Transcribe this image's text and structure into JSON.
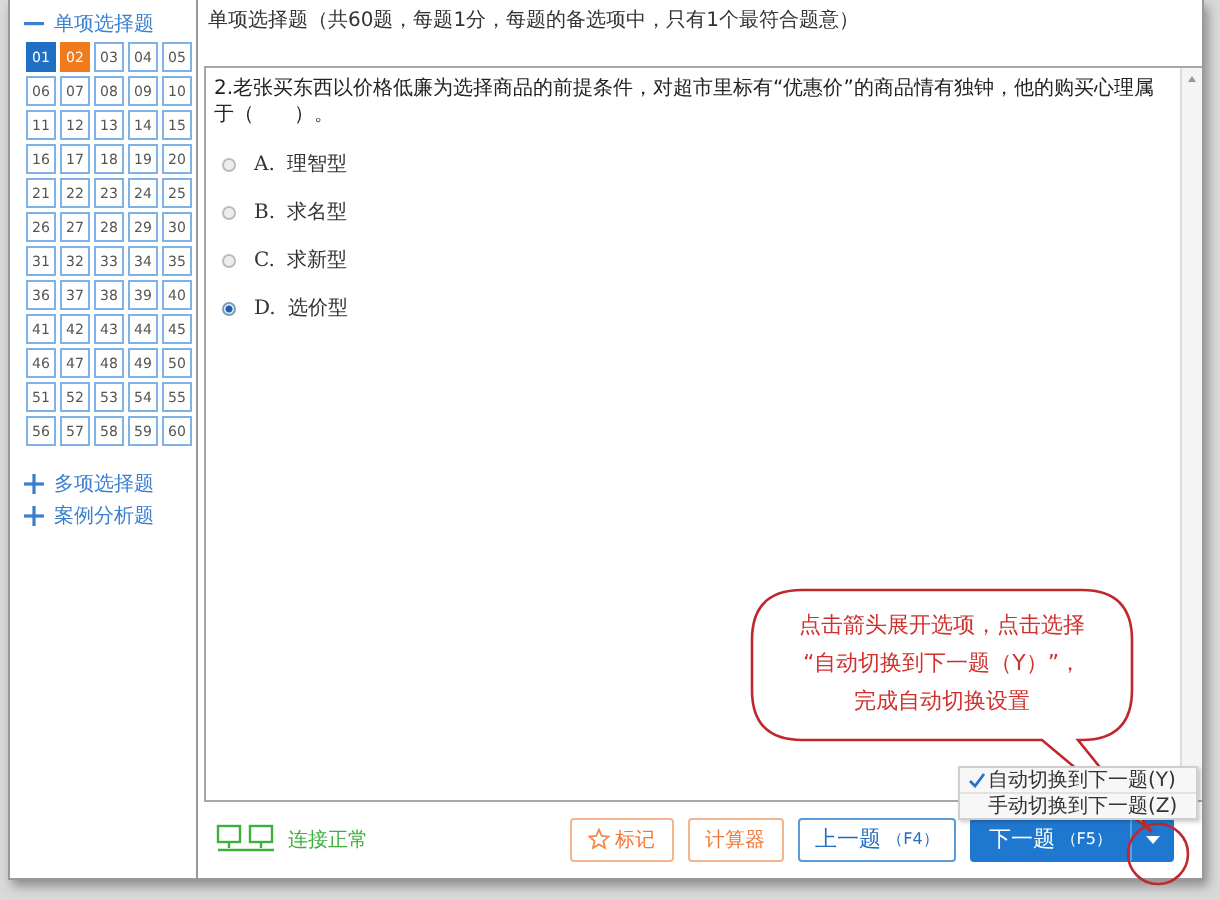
{
  "header": {
    "text": "单项选择题（共60题，每题1分，每题的备选项中，只有1个最符合题意）"
  },
  "sidebar": {
    "sections": [
      {
        "label": "单项选择题",
        "expanded": true,
        "items": [
          {
            "label": "01",
            "answered": true,
            "selected": false
          },
          {
            "label": "02",
            "answered": false,
            "selected": true
          },
          {
            "label": "03",
            "answered": false,
            "selected": false
          },
          {
            "label": "04",
            "answered": false,
            "selected": false
          },
          {
            "label": "05",
            "answered": false,
            "selected": false
          },
          {
            "label": "06",
            "answered": false,
            "selected": false
          },
          {
            "label": "07",
            "answered": false,
            "selected": false
          },
          {
            "label": "08",
            "answered": false,
            "selected": false
          },
          {
            "label": "09",
            "answered": false,
            "selected": false
          },
          {
            "label": "10",
            "answered": false,
            "selected": false
          },
          {
            "label": "11",
            "answered": false,
            "selected": false
          },
          {
            "label": "12",
            "answered": false,
            "selected": false
          },
          {
            "label": "13",
            "answered": false,
            "selected": false
          },
          {
            "label": "14",
            "answered": false,
            "selected": false
          },
          {
            "label": "15",
            "answered": false,
            "selected": false
          },
          {
            "label": "16",
            "answered": false,
            "selected": false
          },
          {
            "label": "17",
            "answered": false,
            "selected": false
          },
          {
            "label": "18",
            "answered": false,
            "selected": false
          },
          {
            "label": "19",
            "answered": false,
            "selected": false
          },
          {
            "label": "20",
            "answered": false,
            "selected": false
          },
          {
            "label": "21",
            "answered": false,
            "selected": false
          },
          {
            "label": "22",
            "answered": false,
            "selected": false
          },
          {
            "label": "23",
            "answered": false,
            "selected": false
          },
          {
            "label": "24",
            "answered": false,
            "selected": false
          },
          {
            "label": "25",
            "answered": false,
            "selected": false
          },
          {
            "label": "26",
            "answered": false,
            "selected": false
          },
          {
            "label": "27",
            "answered": false,
            "selected": false
          },
          {
            "label": "28",
            "answered": false,
            "selected": false
          },
          {
            "label": "29",
            "answered": false,
            "selected": false
          },
          {
            "label": "30",
            "answered": false,
            "selected": false
          },
          {
            "label": "31",
            "answered": false,
            "selected": false
          },
          {
            "label": "32",
            "answered": false,
            "selected": false
          },
          {
            "label": "33",
            "answered": false,
            "selected": false
          },
          {
            "label": "34",
            "answered": false,
            "selected": false
          },
          {
            "label": "35",
            "answered": false,
            "selected": false
          },
          {
            "label": "36",
            "answered": false,
            "selected": false
          },
          {
            "label": "37",
            "answered": false,
            "selected": false
          },
          {
            "label": "38",
            "answered": false,
            "selected": false
          },
          {
            "label": "39",
            "answered": false,
            "selected": false
          },
          {
            "label": "40",
            "answered": false,
            "selected": false
          },
          {
            "label": "41",
            "answered": false,
            "selected": false
          },
          {
            "label": "42",
            "answered": false,
            "selected": false
          },
          {
            "label": "43",
            "answered": false,
            "selected": false
          },
          {
            "label": "44",
            "answered": false,
            "selected": false
          },
          {
            "label": "45",
            "answered": false,
            "selected": false
          },
          {
            "label": "46",
            "answered": false,
            "selected": false
          },
          {
            "label": "47",
            "answered": false,
            "selected": false
          },
          {
            "label": "48",
            "answered": false,
            "selected": false
          },
          {
            "label": "49",
            "answered": false,
            "selected": false
          },
          {
            "label": "50",
            "answered": false,
            "selected": false
          },
          {
            "label": "51",
            "answered": false,
            "selected": false
          },
          {
            "label": "52",
            "answered": false,
            "selected": false
          },
          {
            "label": "53",
            "answered": false,
            "selected": false
          },
          {
            "label": "54",
            "answered": false,
            "selected": false
          },
          {
            "label": "55",
            "answered": false,
            "selected": false
          },
          {
            "label": "56",
            "answered": false,
            "selected": false
          },
          {
            "label": "57",
            "answered": false,
            "selected": false
          },
          {
            "label": "58",
            "answered": false,
            "selected": false
          },
          {
            "label": "59",
            "answered": false,
            "selected": false
          },
          {
            "label": "60",
            "answered": false,
            "selected": false
          }
        ]
      },
      {
        "label": "多项选择题",
        "expanded": false
      },
      {
        "label": "案例分析题",
        "expanded": false
      }
    ]
  },
  "question": {
    "text": "2.老张买东西以价格低廉为选择商品的前提条件，对超市里标有“优惠价”的商品情有独钟，他的购买心理属于（　　）。",
    "options": [
      {
        "letter": "A.",
        "text": "理智型",
        "selected": false
      },
      {
        "letter": "B.",
        "text": "求名型",
        "selected": false
      },
      {
        "letter": "C.",
        "text": "求新型",
        "selected": false
      },
      {
        "letter": "D.",
        "text": "选价型",
        "selected": true
      }
    ]
  },
  "footer": {
    "status": "连接正常",
    "buttons": [
      {
        "kind": "mark",
        "label": "标记"
      },
      {
        "kind": "plain",
        "label": "计算器"
      },
      {
        "kind": "secondary",
        "label": "上一题",
        "hint": "（F4）"
      },
      {
        "kind": "primary",
        "label": "下一题",
        "hint": "（F5）"
      }
    ]
  },
  "menu": {
    "items": [
      {
        "label": "自动切换到下一题(Y)",
        "checked": true
      },
      {
        "label": "手动切换到下一题(Z)",
        "checked": false
      }
    ]
  },
  "callout": {
    "lines": [
      "点击箭头展开选项，点击选择",
      "“自动切换到下一题（Y）”，",
      "完成自动切换设置"
    ]
  }
}
